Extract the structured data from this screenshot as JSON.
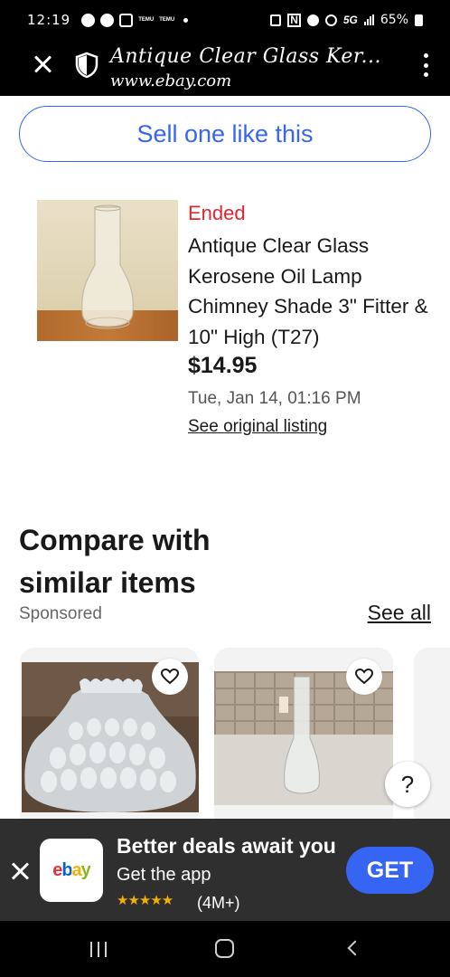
{
  "status_bar": {
    "time": "12:19",
    "temu_label_1": "TEMU",
    "temu_label_2": "TEMU",
    "network": "5G",
    "battery": "65%"
  },
  "browser": {
    "title": "Antique Clear Glass Ker...",
    "url": "www.ebay.com"
  },
  "sell_button": "Sell one like this",
  "listing": {
    "status": "Ended",
    "title": "Antique Clear Glass Kerosene Oil Lamp Chimney Shade 3\" Fitter & 10\" High (T27)",
    "price": "$14.95",
    "end_date": "Tue, Jan 14, 01:16 PM",
    "link": "See original listing"
  },
  "compare": {
    "title": "Compare with similar items",
    "sponsored": "Sponsored",
    "see_all": "See all"
  },
  "help_label": "?",
  "app_banner": {
    "logo_text": "ebay",
    "headline": "Better deals await you",
    "subtitle": "Get the app",
    "stars": "★★★★★",
    "rating_count": "(4M+)",
    "get_button": "GET"
  },
  "colors": {
    "accent_blue": "#3665f3",
    "ended_red": "#e0262e",
    "banner_bg": "#2f2f2f"
  }
}
